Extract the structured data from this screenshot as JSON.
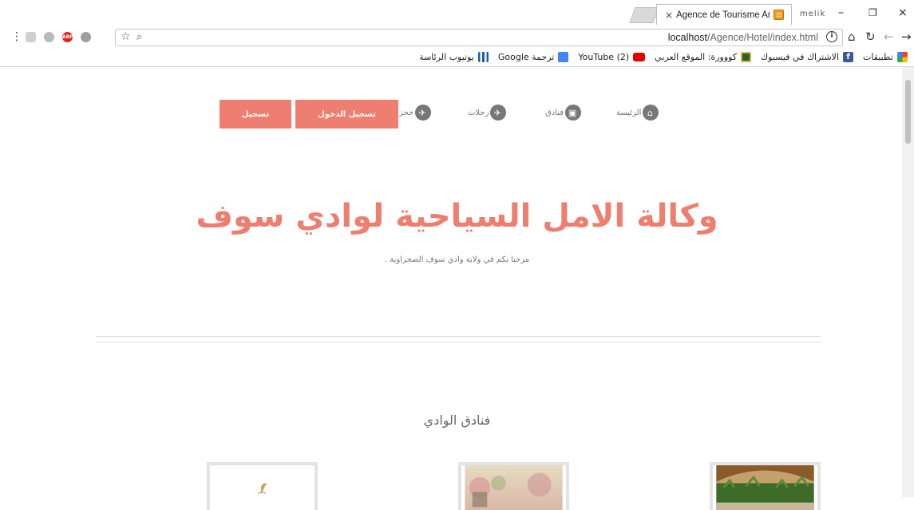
{
  "browser": {
    "tab_title": "Agence de Tourisme Ama",
    "tab_close": "×",
    "profile_label": "melik",
    "window_controls": [
      "–",
      "❐",
      "×"
    ],
    "url_host": "localhost",
    "url_path": "/Agence/Hotel/index.html",
    "star_icon": "☆",
    "search_icon": "⌕",
    "info_icon": "i",
    "home_icon": "⌂",
    "reload_icon": "↻",
    "back_icon": "←",
    "forward_icon": "→",
    "menu_icon": "⋮",
    "bookmarks": [
      {
        "label": "تطبيقات",
        "icon": "apps-grid",
        "color": "#e94235"
      },
      {
        "label": "الاشتراك في فيسبوك",
        "icon": "facebook-icon",
        "color": "#3b5998"
      },
      {
        "label": "كووورة: الموقع العربي",
        "icon": "kooora-icon",
        "color": "#2d5f2d"
      },
      {
        "label": "YouTube (2)",
        "icon": "youtube-icon",
        "color": "#e00000"
      },
      {
        "label": "ترجمة Google",
        "icon": "google-translate-icon",
        "color": "#4285f4"
      },
      {
        "label": "يوتيوب الرئاسة",
        "icon": "bar-chart-icon",
        "color": "#1a5fa8"
      }
    ]
  },
  "site": {
    "accent": "#ee7f70",
    "nav": {
      "register_label": "تسجيل",
      "login_label": "تسجيل الدخول",
      "items": [
        {
          "label": "حجز",
          "icon": "plane-icon"
        },
        {
          "label": "رحلات",
          "icon": "plane-icon"
        },
        {
          "label": "فنادق",
          "icon": "hotel-icon"
        },
        {
          "label": "الرئيسة",
          "icon": "home-icon"
        }
      ]
    },
    "hero": {
      "title": "وكالة الامل السياحية لوادي سوف",
      "subtitle": "مرحبا بكم في ولاية وادي سوف الصحراوية ."
    },
    "hotels_section": {
      "title": "فنادق الوادي"
    }
  }
}
